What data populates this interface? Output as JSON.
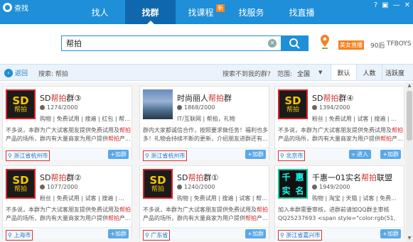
{
  "app": {
    "title": "查找"
  },
  "nav": {
    "tabs": [
      {
        "label": "找人"
      },
      {
        "label": "找群"
      },
      {
        "label": "找课程",
        "badge": "新"
      },
      {
        "label": "找服务"
      },
      {
        "label": "找直播"
      }
    ]
  },
  "window": {
    "help": "?",
    "skin": "▣",
    "minimize": "—",
    "close": "✕"
  },
  "search": {
    "value": "帮拍",
    "clear": "×"
  },
  "user": {
    "vip": "美女直播",
    "age": "90后",
    "tag": "TFBOYS"
  },
  "filter": {
    "back": "返回",
    "search_label": "搜索: 帮拍",
    "notfound": "搜索不到我的群?",
    "range_label": "范围:",
    "range_value": "全国",
    "range_caret": "▼",
    "sort": [
      "默认",
      "人数",
      "活跃度"
    ]
  },
  "cards": [
    {
      "name_pre": "SD",
      "name_hl": "帮拍",
      "name_post": "群③",
      "count": "1274/2000",
      "tags": "购物 | 免费试用 | 搜遍 | 红包 | 帮...",
      "desc_pre": "不多说，本群为广大试客朋友提供免费试用及",
      "desc_hl1": "帮拍",
      "desc_mid": "产品的场所，群内有大量商家为用户提供",
      "desc_hl2": "帮拍",
      "desc_post": "产...",
      "location": "浙江省杭州市",
      "join": "+加群",
      "thumb": "sd",
      "logo_top": "SD",
      "logo_bottom": "帮拍"
    },
    {
      "name_pre": "时尚丽人",
      "name_hl": "帮拍",
      "name_post": "群",
      "count": "1868/2000",
      "tags": "IT/互联网 | 帮拍，礼物",
      "desc_pre": "群内大家都诚信合作，按照要求做任务！福利也多多！礼物会持续不断的更新，介绍朋友进群还有",
      "desc_hl1": "",
      "desc_mid": "",
      "desc_hl2": "",
      "desc_post": "...",
      "location": "浙江省杭州市",
      "join": "+加群",
      "thumb": "sea"
    },
    {
      "name_pre": "SD",
      "name_hl": "帮拍",
      "name_post": "群④",
      "count": "1394/2000",
      "tags": "粉丝 | 免费试用 | 试客 | 搜遍 | ...",
      "desc_pre": "不多说，本群为广大试客朋友提供免费试用及",
      "desc_hl1": "帮拍",
      "desc_mid": "产品的场所，群内有大量商家为用户提供",
      "desc_hl2": "帮拍",
      "desc_post": "产...",
      "location": "北京市",
      "enter": "» 进入",
      "join": "+加群",
      "thumb": "sd",
      "logo_top": "SD",
      "logo_bottom": "帮拍"
    },
    {
      "name_pre": "SD",
      "name_hl": "帮拍",
      "name_post": "群②",
      "count": "1077/2000",
      "tags": "粉丝 | 免费试用 | 试客 | 搜遍 | ...",
      "desc_pre": "不多说，本群为广大试客朋友提供免费试用及",
      "desc_hl1": "帮拍",
      "desc_mid": "产品的场所，群内有大量商家为用户提供",
      "desc_hl2": "帮拍",
      "desc_post": "产...",
      "location": "上海市",
      "join": "+加群",
      "thumb": "sd",
      "logo_top": "SD",
      "logo_bottom": "帮拍"
    },
    {
      "name_pre": "SD",
      "name_hl": "帮拍",
      "name_post": "群①",
      "count": "1240/2000",
      "tags": "购物 | 免费试用 | 搜遍 | 试客 | 帮...",
      "desc_pre": "不多说，本群为广大试客朋友提供免费试用及",
      "desc_hl1": "帮拍",
      "desc_mid": "产品的场所，群内有大量商家为用户提供",
      "desc_hl2": "帮拍",
      "desc_post": "产...",
      "location": "广东省",
      "join": "+加群",
      "thumb": "sd",
      "logo_top": "SD",
      "logo_bottom": "帮拍"
    },
    {
      "name_pre": "千惠一01实名",
      "name_hl": "帮拍",
      "name_post": "联盟",
      "count": "1949/2000",
      "tags": "购物 | 淘宝 | 天猫 | 试客 | 免费...",
      "desc_pre": "加入本群需要审核，进群前请加QQ群主审核QQ25237693 <span style=\"color:rgb(51, \">天猫淘宝刷...",
      "desc_hl1": "",
      "desc_mid": "",
      "desc_hl2": "",
      "desc_post": "",
      "location": "浙江省嘉兴市",
      "join": "+加群",
      "thumb": "ctext",
      "thumb_chars": [
        "千",
        "惠",
        "实",
        "名"
      ]
    }
  ],
  "colors": {
    "brand": "#1e8fd8",
    "highlight": "#d0302b",
    "accent": "#f5821f"
  }
}
